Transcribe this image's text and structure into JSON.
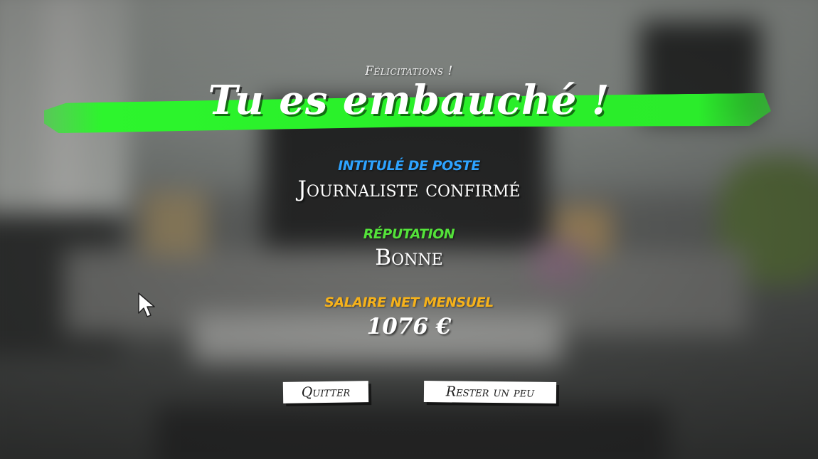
{
  "header": {
    "congrats": "Félicitations !",
    "title": "Tu es embauché !"
  },
  "job": {
    "label": "Intitulé de poste",
    "value": "Journaliste confirmé"
  },
  "reputation": {
    "label": "Réputation",
    "value": "Bonne"
  },
  "salary": {
    "label": "Salaire net mensuel",
    "value": "1076 €"
  },
  "buttons": {
    "quit": "Quitter",
    "stay": "Rester un peu"
  },
  "colors": {
    "highlight": "#2df52d",
    "job_label": "#2ea3ff",
    "reputation_label": "#54e23a",
    "salary_label": "#f6b21b"
  },
  "icons": {
    "cursor": "arrow-cursor-icon"
  }
}
